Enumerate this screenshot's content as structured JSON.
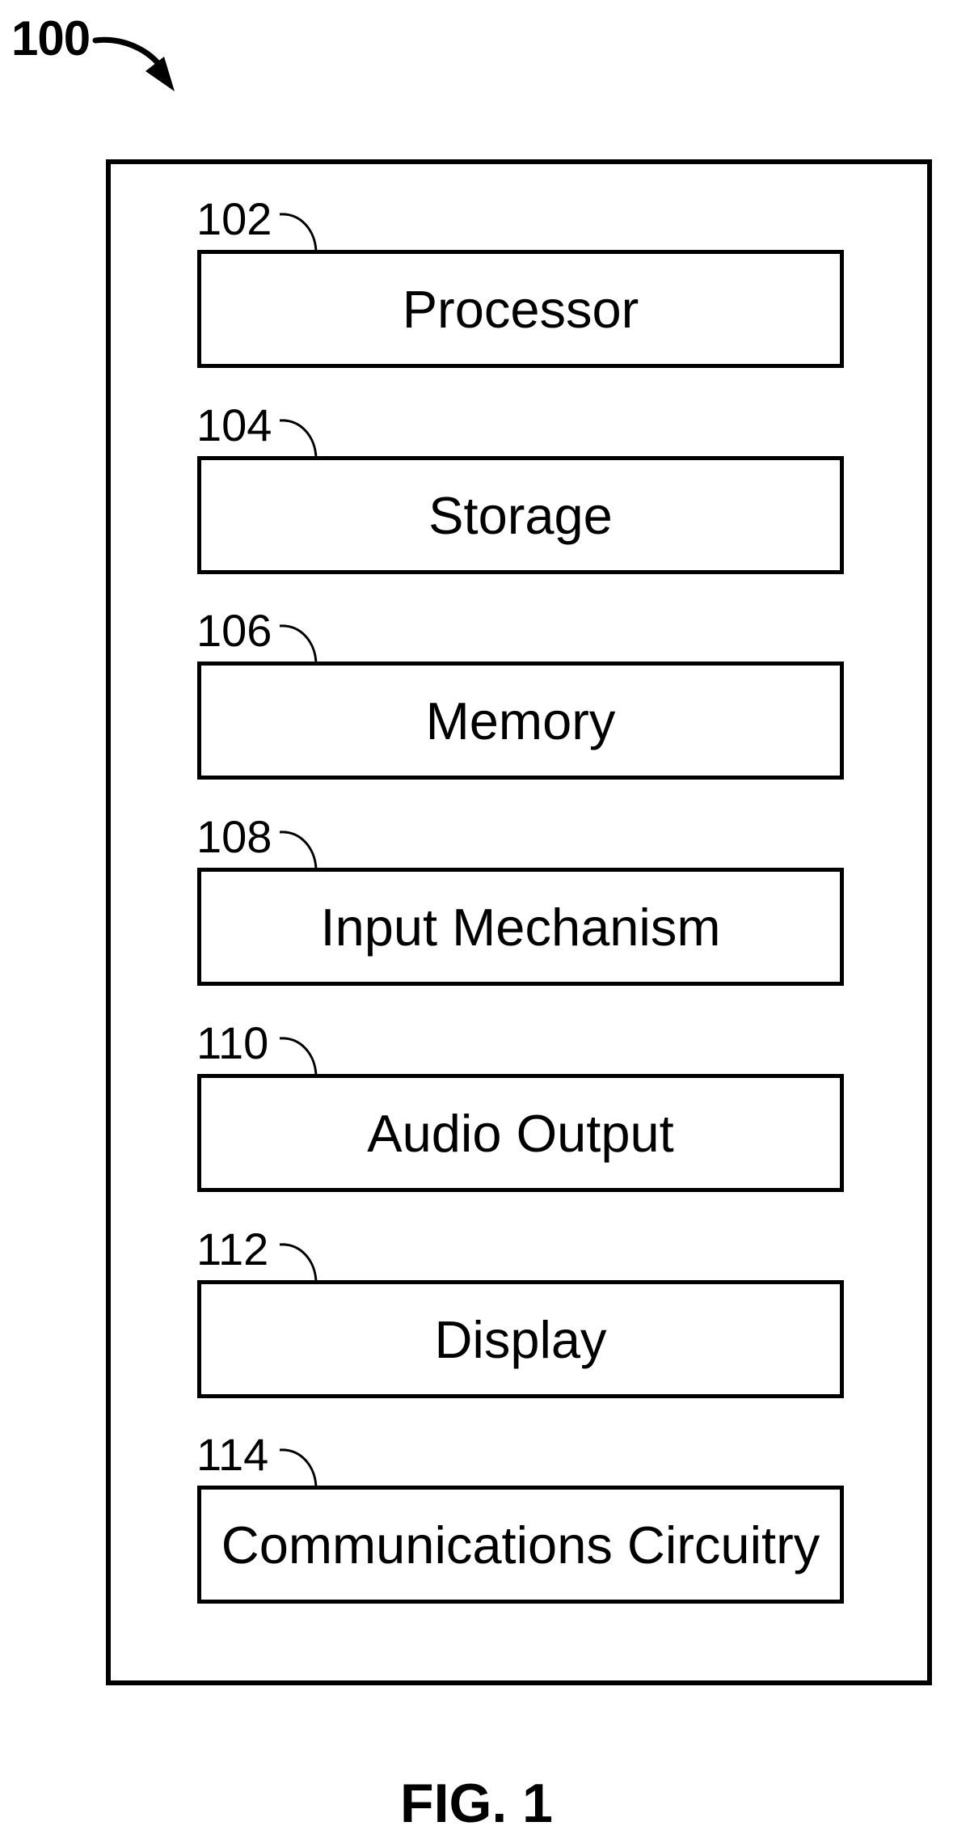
{
  "figure": {
    "reference": "100",
    "caption": "FIG. 1"
  },
  "components": [
    {
      "ref": "102",
      "label": "Processor"
    },
    {
      "ref": "104",
      "label": "Storage"
    },
    {
      "ref": "106",
      "label": "Memory"
    },
    {
      "ref": "108",
      "label": "Input Mechanism"
    },
    {
      "ref": "110",
      "label": "Audio Output"
    },
    {
      "ref": "112",
      "label": "Display"
    },
    {
      "ref": "114",
      "label": "Communications Circuitry"
    }
  ]
}
